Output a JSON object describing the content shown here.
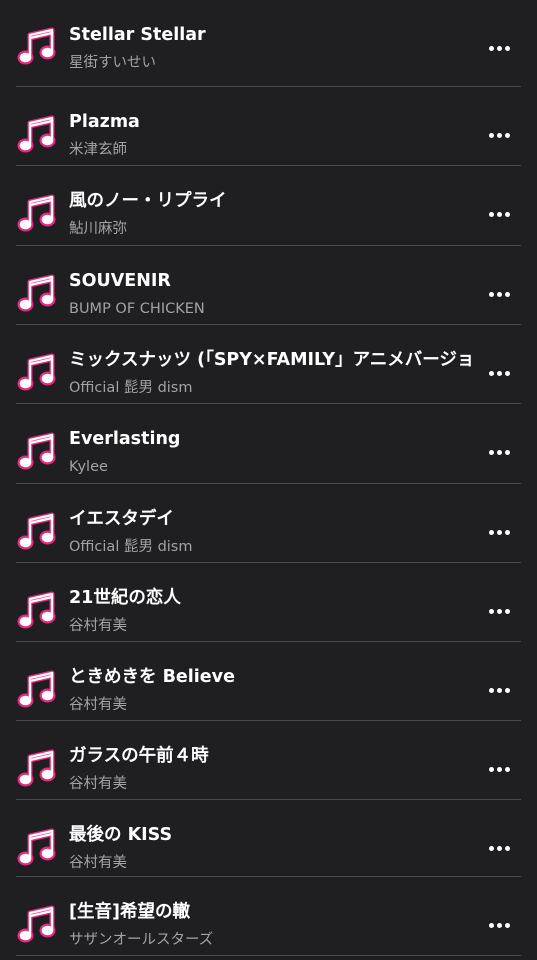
{
  "colors": {
    "background": "#1f1f21",
    "title": "#ffffff",
    "subtitle": "#a2a2a7",
    "divider": "#4a4a4d",
    "icon_accent": "#e8277e"
  },
  "icons": {
    "track": "music-note-icon",
    "more": "more-horizontal-icon"
  },
  "tracks": [
    {
      "title": "Stellar Stellar",
      "artist": "星街すいせい"
    },
    {
      "title": "Plazma",
      "artist": "米津玄師"
    },
    {
      "title": "風のノー・リプライ",
      "artist": "鮎川麻弥"
    },
    {
      "title": "SOUVENIR",
      "artist": "BUMP OF CHICKEN"
    },
    {
      "title": "ミックスナッツ (「SPY×FAMILY」アニメバージョ",
      "artist": "Official 髭男 dism"
    },
    {
      "title": "Everlasting",
      "artist": "Kylee"
    },
    {
      "title": "イエスタデイ",
      "artist": "Official 髭男 dism"
    },
    {
      "title": "21世紀の恋人",
      "artist": "谷村有美"
    },
    {
      "title": "ときめきを Believe",
      "artist": "谷村有美"
    },
    {
      "title": "ガラスの午前４時",
      "artist": "谷村有美"
    },
    {
      "title": "最後の KISS",
      "artist": "谷村有美"
    },
    {
      "title": "[生音]希望の轍",
      "artist": "サザンオールスターズ"
    }
  ]
}
